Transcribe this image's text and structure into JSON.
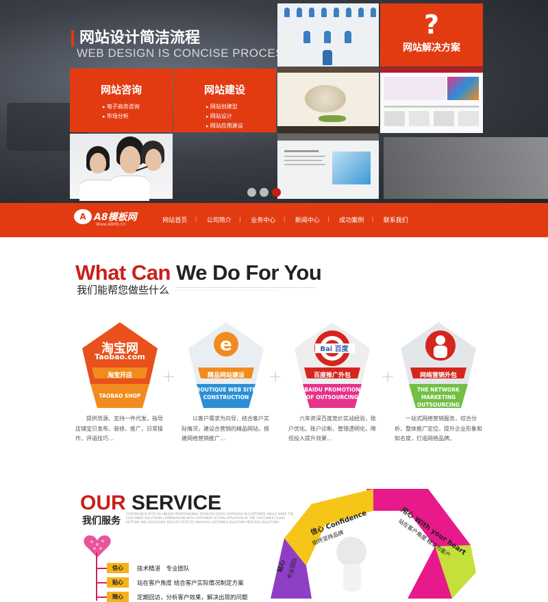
{
  "hero": {
    "title": "网站设计简洁流程",
    "subtitle": "WEB DESIGN IS CONCISE PROCESS",
    "panels": [
      {
        "title": "网站咨询",
        "items": [
          "电子商务咨询",
          "市场分析"
        ]
      },
      {
        "title": "网站建设",
        "items": [
          "网站创建型",
          "网站设计",
          "网站应用建设"
        ]
      }
    ],
    "solution": {
      "glyph": "?",
      "title": "网站解决方案"
    },
    "slides": {
      "count": 3,
      "active": 3
    }
  },
  "nav": {
    "logo": {
      "mark": "A",
      "name": "A8模板网",
      "url": "Www.A8Mb.Cn"
    },
    "items": [
      "网站首页",
      "公司简介",
      "业务中心",
      "新闻中心",
      "成功案例",
      "联系我们"
    ]
  },
  "what": {
    "title_red": "What Can",
    "title_dark": "We Do For You",
    "subtitle": "我们能帮您做些什么"
  },
  "services": [
    {
      "logo": "淘宝网",
      "logo2": "Taobao.com",
      "tag": "淘宝开店",
      "en": "TAOBAO SHOP",
      "color": "#f28b1d",
      "top": "#e8511c",
      "desc": "提供货源、支持一件代发，指导店铺宝贝发布、装修、推广，日常操作，评语技巧…"
    },
    {
      "logo": "e",
      "logo2": "",
      "tag": "精品网站建设",
      "en": "BOUTIQUE WEB SITE CONSTRUCTION",
      "color": "#2b8fd6",
      "top": "#f28b1d",
      "desc": "以客户需求为向导，结合客户实际情况，建设合营销的精品网站，搭建网络营销推广…"
    },
    {
      "logo": "Bai度百度",
      "logo2": "",
      "tag": "百度推广外包",
      "en": "BAIDU PROMOTION OF OUTSOURCING",
      "color": "#e5338a",
      "top": "#d6251c",
      "desc": "六年资深百度竞价实战经验，账户优化、账户诊断、管理透明化，降低投入提升效果…"
    },
    {
      "logo": "",
      "logo2": "",
      "tag": "网络营销外包",
      "en": "THE NETWORK MARKETING OUTSOURCING",
      "color": "#72bf44",
      "top": "#d6251c",
      "desc": "一站式网络营销服务，综合分析，整体推广定位，提升企业形象和知名度，打造网络品牌。"
    }
  ],
  "our_service": {
    "title_red": "OUR",
    "title_dark": "SERVICE",
    "subtitle": "我们服务",
    "english_text": "CONTINUOUS ACTS AS UNIQUE PROFESSIONAL RESIN RECEIVES COVERAGE IN CUSTOMER ANGLE MAKE THE CUSTOMER SOLUTIONS COMBINATION WITH CUSTOMER ACTUAL SITUATION OF THE CUSTOMER CLASS SETTING AND REGULARLY REALIZE EFFECTS ANALYSIS CUSTOMER SOLUTION PROCESS SOLUTIONS",
    "rows": [
      {
        "label": "信心",
        "text": "技术精湛　专业团队"
      },
      {
        "label": "贴心",
        "text": "站在客户角度 结合客户实际情况制定方案"
      },
      {
        "label": "随心",
        "text": "定期回访，分析客户效果，解决出现的问题"
      }
    ],
    "ring_labels": [
      "信心 Confidence",
      "用心 With your heart",
      "贴心"
    ],
    "ring_sub": [
      "始终坚持品牌",
      "站在客户角度 精准为客户",
      "专业团队"
    ]
  },
  "colors": {
    "brand": "#e23b12",
    "red": "#c8201b",
    "pink": "#d81b60",
    "yellow": "#f5b21b"
  }
}
